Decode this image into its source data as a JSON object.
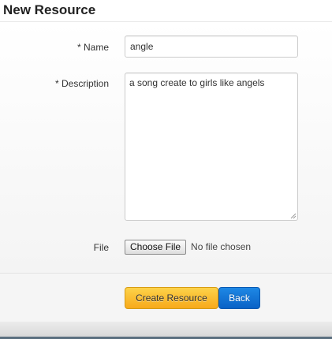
{
  "header": {
    "title": "New Resource"
  },
  "form": {
    "name": {
      "label": "* Name",
      "value": "angle"
    },
    "description": {
      "label": "* Description",
      "value": "a song create to girls like angels"
    },
    "file": {
      "label": "File",
      "button_label": "Choose File",
      "status": "No file chosen"
    }
  },
  "actions": {
    "create_label": "Create Resource",
    "back_label": "Back"
  },
  "colors": {
    "create_button": "#f7a91b",
    "back_button": "#0a62c6",
    "footer_line": "#5b6f7f"
  },
  "icons": {
    "textarea_resize": "resize-grip-icon"
  }
}
